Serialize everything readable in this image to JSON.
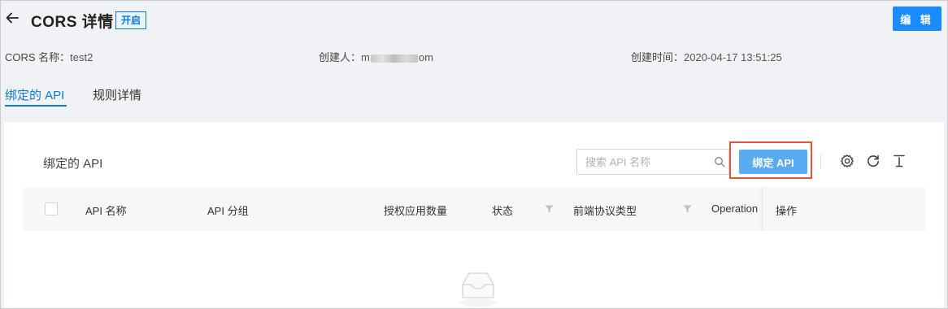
{
  "header": {
    "title": "CORS 详情",
    "status_badge": "开启",
    "edit_label": "编 辑"
  },
  "meta": {
    "cors_name_label": "CORS 名称：",
    "cors_name_value": "test2",
    "creator_label": "创建人：",
    "creator_value_start": "m",
    "creator_value_end": "om",
    "created_time_label": "创建时间：",
    "created_time_value": "2020-04-17 13:51:25"
  },
  "tabs": [
    {
      "label": "绑定的 API",
      "active": true
    },
    {
      "label": "规则详情",
      "active": false
    }
  ],
  "panel": {
    "section_title": "绑定的 API",
    "search_placeholder": "搜索 API 名称",
    "bind_api_label": "绑定 API"
  },
  "table": {
    "columns": [
      {
        "label": "API 名称"
      },
      {
        "label": "API 分组"
      },
      {
        "label": "授权应用数量"
      },
      {
        "label": "状态",
        "filter": true
      },
      {
        "label": "前端协议类型",
        "filter": true
      },
      {
        "label": "Operation"
      },
      {
        "label": "操作"
      }
    ]
  },
  "icons": {
    "back": "arrow-left-icon",
    "search": "search-icon",
    "settings": "gear-icon",
    "refresh": "refresh-icon",
    "export": "export-icon",
    "filter": "filter-icon",
    "empty": "empty-inbox-icon"
  },
  "colors": {
    "primary": "#1a8cff",
    "primary_light": "#5aacf2",
    "highlight": "#e5533d",
    "background": "#f0f2f5"
  }
}
